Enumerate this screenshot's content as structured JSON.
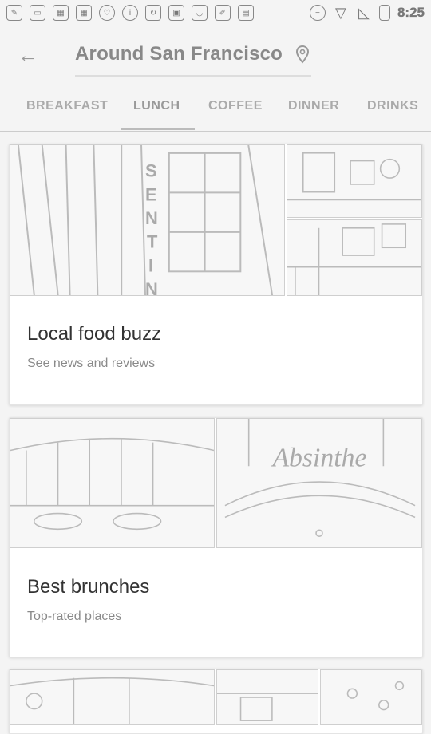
{
  "status_bar": {
    "time": "8:25",
    "left_icons": [
      "wrench-icon",
      "message-icon",
      "image-icon",
      "image-icon",
      "heart-icon",
      "info-icon",
      "sync-icon",
      "lock-icon",
      "android-icon",
      "edit-icon",
      "briefcase-icon"
    ],
    "right_icons": [
      "do-not-disturb-icon",
      "wifi-icon",
      "no-signal-icon",
      "battery-icon"
    ]
  },
  "header": {
    "title": "Around San Francisco"
  },
  "tabs": [
    {
      "label": "BREAKFAST"
    },
    {
      "label": "LUNCH"
    },
    {
      "label": "COFFEE"
    },
    {
      "label": "DINNER"
    },
    {
      "label": "DRINKS"
    }
  ],
  "cards": [
    {
      "title": "Local food buzz",
      "subtitle": "See news and reviews"
    },
    {
      "title": "Best brunches",
      "subtitle": "Top-rated places"
    }
  ]
}
